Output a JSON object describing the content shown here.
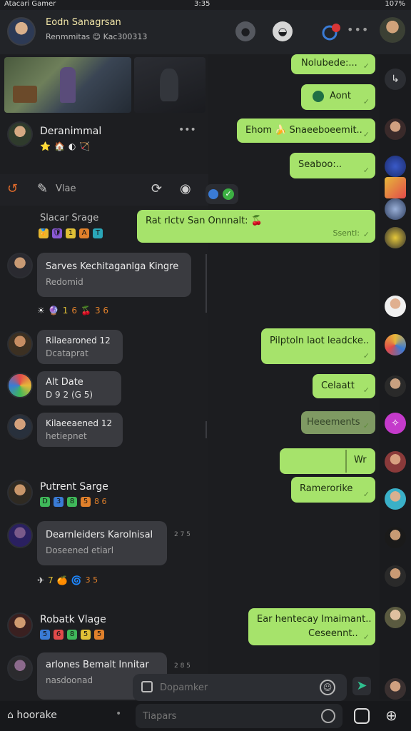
{
  "status_bar": {
    "carrier": "Atacari Gamer",
    "time": "3:35",
    "battery": "107%"
  },
  "header": {
    "name": "Eodn Sanagrsan",
    "status": "Renmmitas 😊 Kac300313",
    "icons": [
      "people-icon",
      "profile-icon",
      "badge-icon",
      "more-icon"
    ]
  },
  "left_list": {
    "toolrow_label": "Vlae",
    "rows": [
      {
        "title": "Deranimmal",
        "icons": [
          "⭐",
          "🏠",
          "◐",
          "🏹"
        ]
      },
      {
        "title": "Slacar Srage",
        "icons": [
          "🏅",
          "🛡",
          "1",
          "A",
          "T"
        ]
      },
      {
        "title": "Sarves Kechitaganlga Kingre",
        "sub": "Redomid",
        "icons": [
          "☀",
          "🔮",
          "1",
          "6",
          "🍒",
          "3 6"
        ]
      },
      {
        "title": "Rilaearoned 12",
        "sub": "Dcataprat"
      },
      {
        "title": "Alt Date",
        "sub": "D 9 2 (G 5)"
      },
      {
        "title": "Kilaeeaened 12",
        "sub": "hetiepnet"
      },
      {
        "title": "Putrent Sarge",
        "icons": [
          "D",
          "3",
          "8",
          "5",
          "8 6"
        ]
      },
      {
        "title": "Dearnleiders Karolnisal",
        "sub": "Doseened etiarl",
        "meta": "2 7 5",
        "icons": [
          "✈",
          "7",
          "🍊",
          "🌀",
          "3 5"
        ]
      },
      {
        "title": "Robatk Vlage",
        "icons": [
          "5",
          "6",
          "8",
          "5",
          "5"
        ]
      },
      {
        "title": "arlones Bemalt Innitar",
        "sub": "nasdoonad",
        "meta": "2 8 5"
      }
    ]
  },
  "messages_out": [
    {
      "text": "Nolubede:..."
    },
    {
      "text": "Aont"
    },
    {
      "text": "Ehom 🍌 Snaeeboeemit.."
    },
    {
      "text": "Seaboo:.."
    },
    {
      "text": "Rat rlctv San Onnnalt: 🍒"
    },
    {
      "text": "Ssentl:"
    },
    {
      "text": "Pilptoln laot leadcke.."
    },
    {
      "text": "Celaatt"
    },
    {
      "text": "Heeements"
    },
    {
      "text": "Wr"
    },
    {
      "text": "Ramerorike"
    },
    {
      "text": "Ear hentecay Imaimant.."
    },
    {
      "text": "Ceseennt.."
    }
  ],
  "composer": {
    "placeholder": "Dopamker"
  },
  "bottombar": {
    "left_label": "hoorake",
    "search_placeholder": "Tiapars"
  },
  "colors": {
    "bubble_out": "#a6e36b",
    "bubble_in": "#3a3b40",
    "background": "#1c1d20"
  }
}
